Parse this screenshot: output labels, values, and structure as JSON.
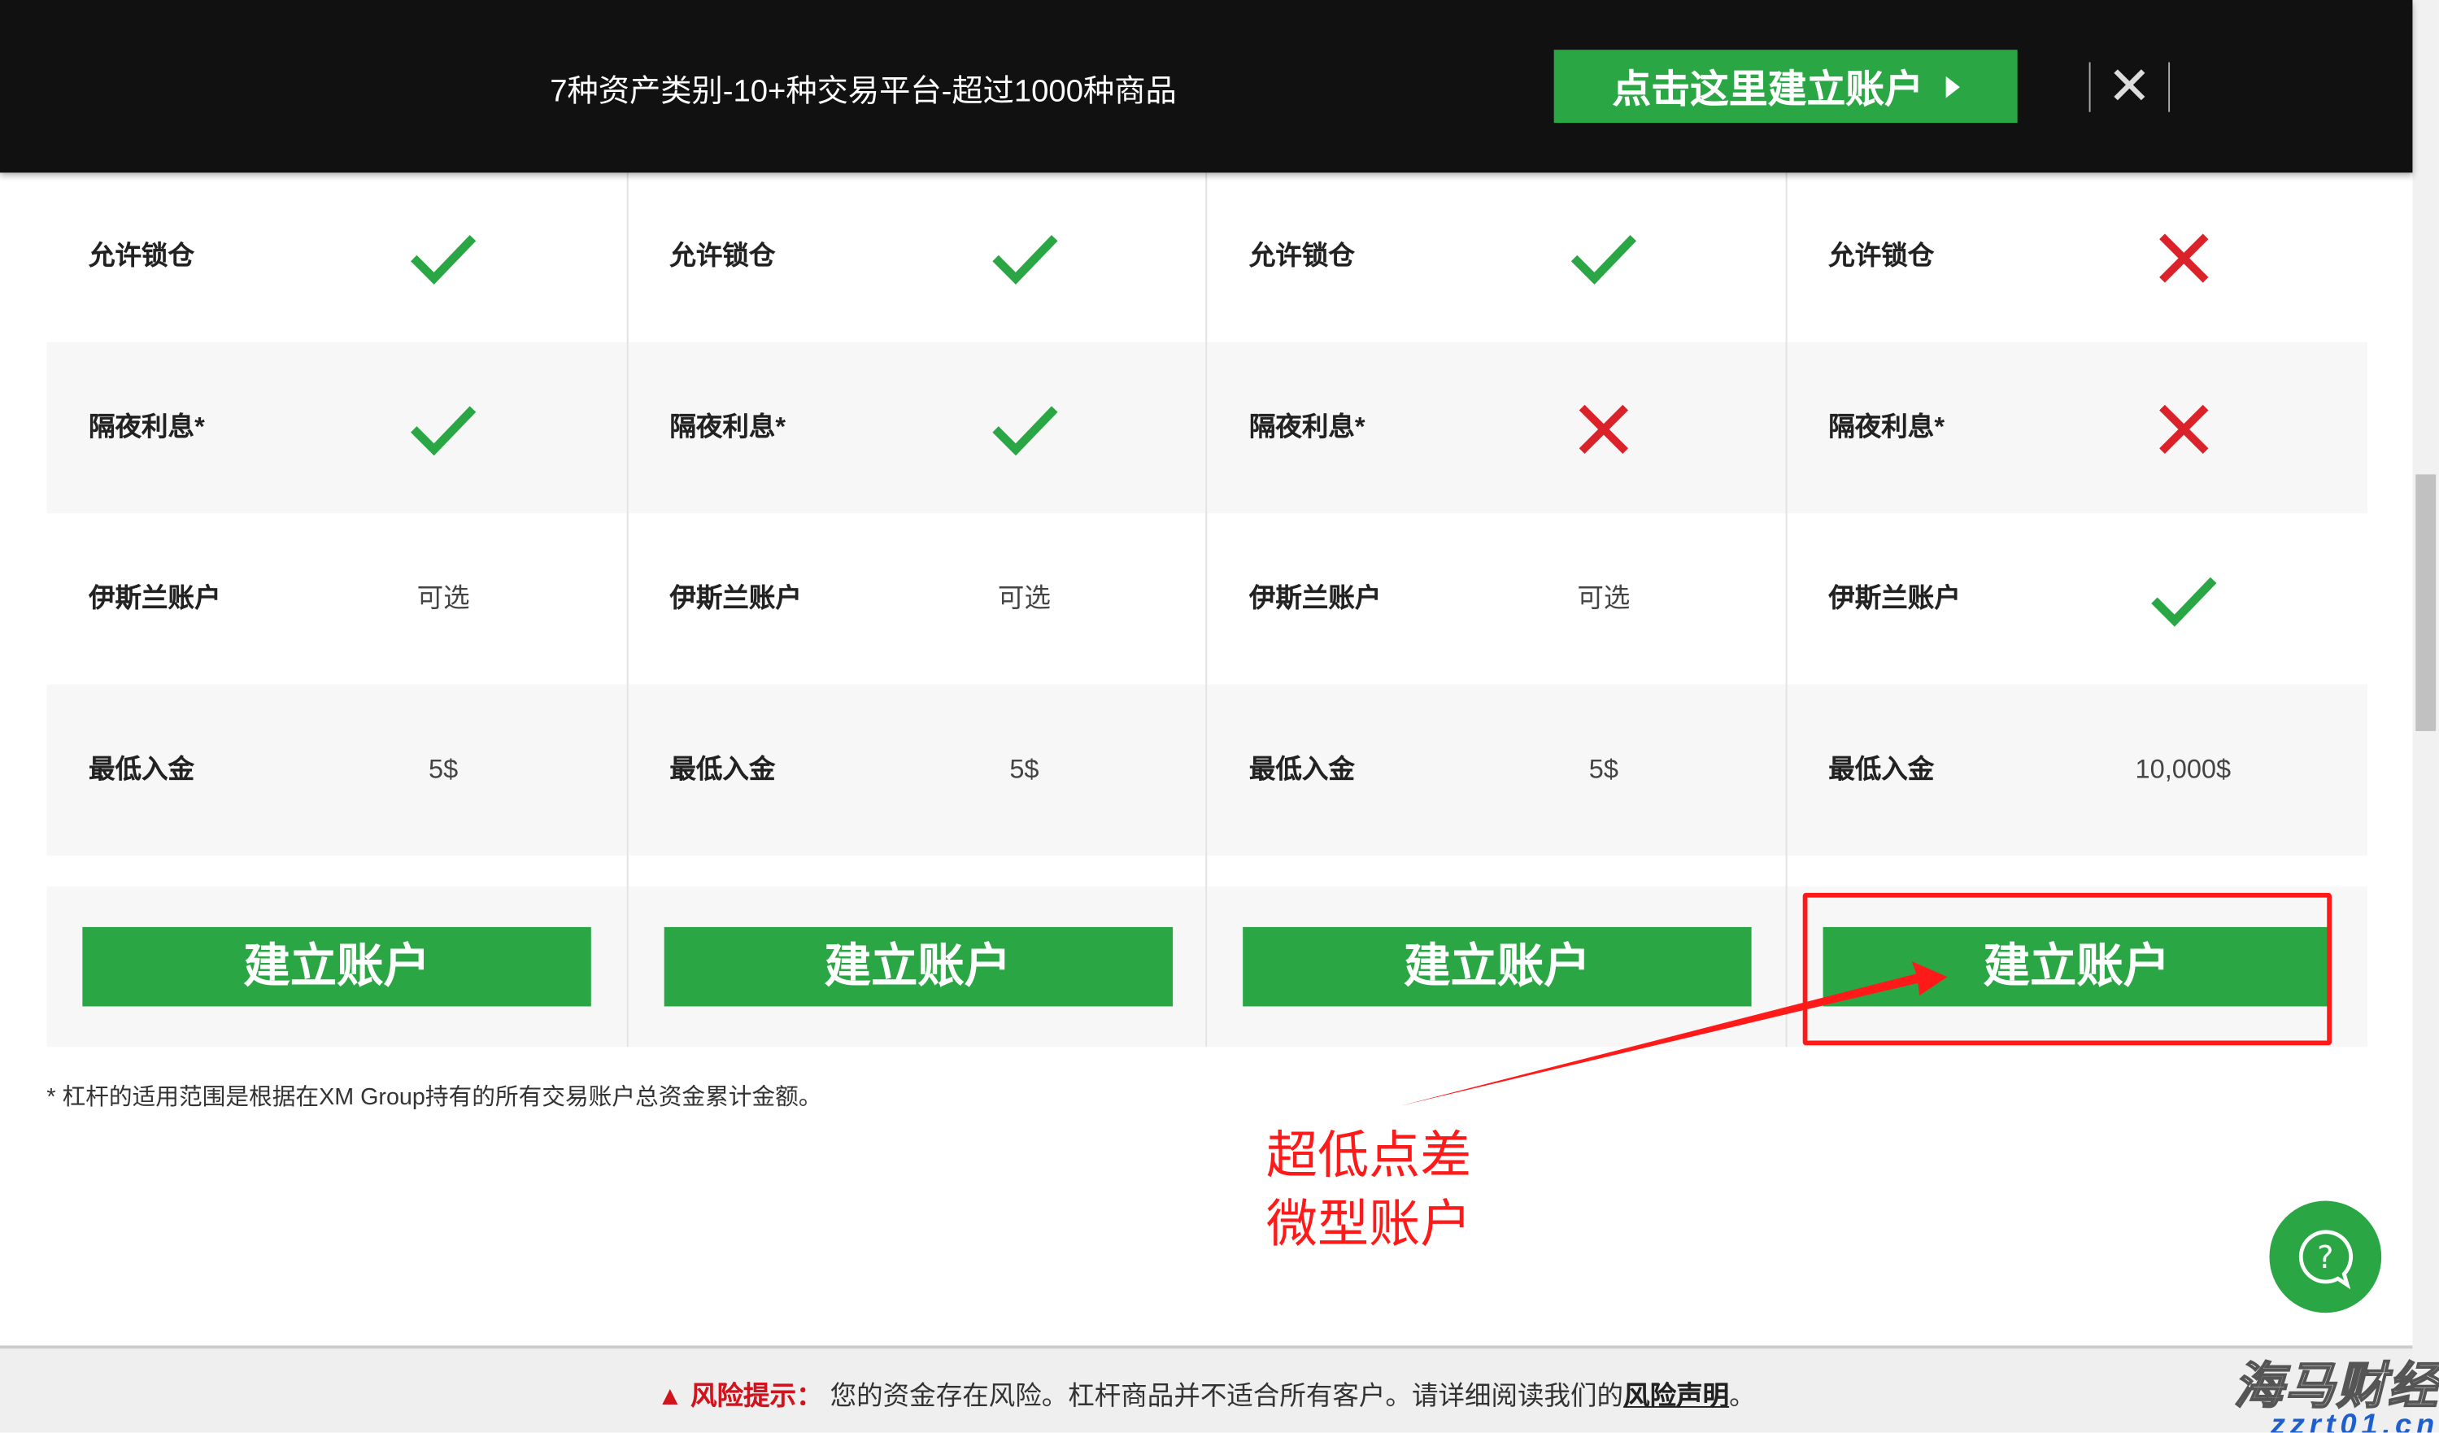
{
  "banner": {
    "text": "7种资产类别-10+种交易平台-超过1000种商品",
    "cta_label": "点击这里建立账户",
    "close_icon": "close-icon"
  },
  "columns": [
    {
      "rows": [
        {
          "label": "允许锁仓",
          "value": "check"
        },
        {
          "label": "隔夜利息*",
          "value": "check"
        },
        {
          "label": "伊斯兰账户",
          "value": "可选"
        },
        {
          "label": "最低入金",
          "value": "5$"
        }
      ],
      "button": "建立账户"
    },
    {
      "rows": [
        {
          "label": "允许锁仓",
          "value": "check"
        },
        {
          "label": "隔夜利息*",
          "value": "check"
        },
        {
          "label": "伊斯兰账户",
          "value": "可选"
        },
        {
          "label": "最低入金",
          "value": "5$"
        }
      ],
      "button": "建立账户"
    },
    {
      "rows": [
        {
          "label": "允许锁仓",
          "value": "check"
        },
        {
          "label": "隔夜利息*",
          "value": "cross"
        },
        {
          "label": "伊斯兰账户",
          "value": "可选"
        },
        {
          "label": "最低入金",
          "value": "5$"
        }
      ],
      "button": "建立账户"
    },
    {
      "rows": [
        {
          "label": "允许锁仓",
          "value": "cross"
        },
        {
          "label": "隔夜利息*",
          "value": "cross"
        },
        {
          "label": "伊斯兰账户",
          "value": "check"
        },
        {
          "label": "最低入金",
          "value": "10,000$"
        }
      ],
      "button": "建立账户"
    }
  ],
  "footnote": "* 杠杆的适用范围是根据在XM Group持有的所有交易账户总资金累计金额。",
  "annotation": {
    "line1": "超低点差",
    "line2": "微型账户"
  },
  "risk": {
    "label": "风险提示：",
    "text": "您的资金存在风险。杠杆商品并不适合所有客户。请详细阅读我们的",
    "link": "风险声明",
    "end": "。"
  },
  "watermark": {
    "line1": "海马财经",
    "line2": "zzrt01.cn"
  },
  "colors": {
    "green": "#2aa744",
    "check": "#2aa744",
    "cross": "#d9222a",
    "annotation": "#ff1a1a"
  }
}
